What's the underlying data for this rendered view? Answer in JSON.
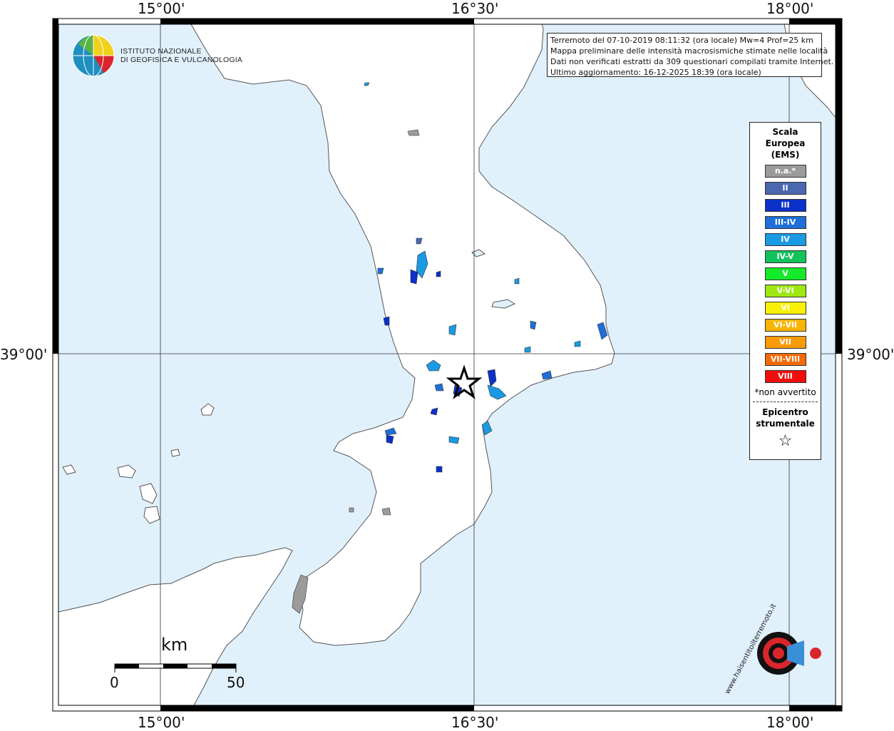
{
  "colors": {
    "sea": "#e1f1fc",
    "land": "#ffffff",
    "na": "#9b9b9b",
    "II": "#4a67b0",
    "III": "#0b31c9",
    "III-IV": "#1e6fd8",
    "IV": "#1a9ae2",
    "IV-V": "#12c25b",
    "V": "#14e92a",
    "V-VI": "#9ee812",
    "VI": "#f8f007",
    "VI-VII": "#f8b508",
    "VII": "#f89b08",
    "VII-VIII": "#f56a06",
    "VIII": "#f20d0d"
  },
  "axes": {
    "top_ticks": [
      "15°00'",
      "16°30'",
      "18°00'"
    ],
    "bottom_ticks": [
      "15°00'",
      "16°30'",
      "18°00'"
    ],
    "left_ticks": [
      "39°00'"
    ],
    "right_ticks": [
      "39°00'"
    ]
  },
  "info_box": {
    "line1": "Terremoto del 07-10-2019 08:11:32 (ora locale) Mw=4 Prof=25 km",
    "line2": "Mappa preliminare delle intensità macrosismiche stimate nelle località",
    "line3": "Dati non verificati estratti da 309 questionari compilati tramite Internet.",
    "line4": "Ultimo aggiornamento: 16-12-2025 18:39 (ora locale)"
  },
  "ingv": {
    "line1": "ISTITUTO NAZIONALE",
    "line2": "DI GEOFISICA E VULCANOLOGIA"
  },
  "legend": {
    "title_line1": "Scala",
    "title_line2": "Europea",
    "title_line3": "(EMS)",
    "items": [
      {
        "label": "n.a.*",
        "color_key": "na"
      },
      {
        "label": "II",
        "color_key": "II"
      },
      {
        "label": "III",
        "color_key": "III"
      },
      {
        "label": "III-IV",
        "color_key": "III-IV"
      },
      {
        "label": "IV",
        "color_key": "IV"
      },
      {
        "label": "IV-V",
        "color_key": "IV-V"
      },
      {
        "label": "V",
        "color_key": "V"
      },
      {
        "label": "V-VI",
        "color_key": "V-VI"
      },
      {
        "label": "VI",
        "color_key": "VI"
      },
      {
        "label": "VI-VII",
        "color_key": "VI-VII"
      },
      {
        "label": "VII",
        "color_key": "VII"
      },
      {
        "label": "VII-VIII",
        "color_key": "VII-VIII"
      },
      {
        "label": "VIII",
        "color_key": "VIII"
      }
    ],
    "note": "*non avvertito",
    "epicenter_line1": "Epicentro",
    "epicenter_line2": "strumentale",
    "epicenter_symbol": "☆"
  },
  "scale_bar": {
    "unit": "km",
    "start": "0",
    "end": "50"
  },
  "hsit_logo": {
    "text": "www.haisentitoilterremoto.it"
  }
}
